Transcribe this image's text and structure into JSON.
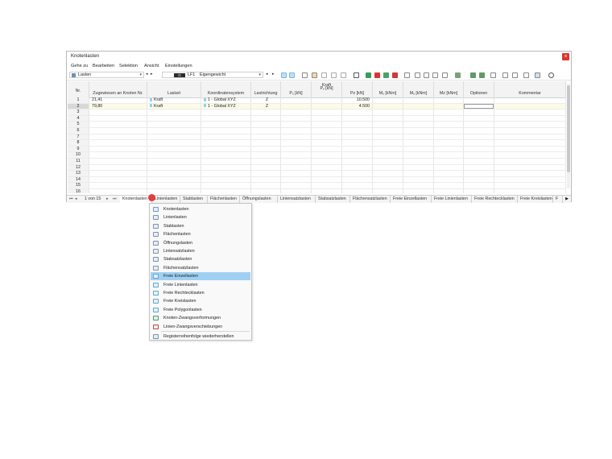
{
  "window": {
    "title": "Knotenlasten",
    "close_glyph": "×"
  },
  "menubar": [
    "Gehe zu",
    "Bearbeiten",
    "Selektion",
    "Ansicht",
    "Einstellungen"
  ],
  "toolbar": {
    "category": "Lasten",
    "loadcase_badge": "G",
    "loadcase_id": "LF1",
    "loadcase_name": "Eigengewicht"
  },
  "table": {
    "headers": {
      "nr": "Nr.",
      "knoten": "Zugewiesen an Knoten Nr.",
      "lastart": "Lastart",
      "koord": "Koordinatensystem",
      "richtung": "Lastrichtung",
      "kraft_group": "Kraft",
      "px": "Pₓ [kN]",
      "py": "Pᵧ [kN]",
      "pz": "Pz [kN]",
      "mx": "Mₓ [kNm]",
      "my": "Mᵧ [kNm]",
      "mz": "Mz [kNm]",
      "optionen": "Optionen",
      "kommentar": "Kommentar"
    },
    "rows": [
      {
        "nr": "1",
        "knoten": "21,41",
        "lastart": "Kraft",
        "koord": "1 - Global XYZ",
        "richtung": "Z",
        "pz": "10.500"
      },
      {
        "nr": "2",
        "knoten": "79,80",
        "lastart": "Kraft",
        "koord": "1 - Global XYZ",
        "richtung": "Z",
        "pz": "4.500"
      },
      {
        "nr": "3"
      },
      {
        "nr": "4"
      },
      {
        "nr": "5"
      },
      {
        "nr": "6"
      },
      {
        "nr": "7"
      },
      {
        "nr": "8"
      },
      {
        "nr": "9"
      },
      {
        "nr": "10"
      },
      {
        "nr": "11"
      },
      {
        "nr": "12"
      },
      {
        "nr": "13"
      },
      {
        "nr": "14"
      },
      {
        "nr": "15"
      },
      {
        "nr": "16"
      }
    ]
  },
  "tabbar": {
    "page_info": "1 von 15",
    "tabs": [
      "Knotenlasten",
      "Linienlasten",
      "Stablasten",
      "Flächenlasten",
      "Öffnungslasten",
      "Liniensatzlasten",
      "Stabsatzlasten",
      "Flächensatzlasten",
      "Freie Einzellasten",
      "Freie Linienlasten",
      "Freie Rechtecklasten",
      "Freie Kreislasten",
      "F"
    ]
  },
  "context_menu": {
    "items": [
      "Knotenlasten",
      "Linienlasten",
      "Stablasten",
      "Flächenlasten",
      "Öffnungslasten",
      "Liniensatzlasten",
      "Stabsatzlasten",
      "Flächensatzlasten",
      "Freie Einzellasten",
      "Freie Linienlasten",
      "Freie Rechtecklasten",
      "Freie Kreislasten",
      "Freie Polygonlasten",
      "Knoten-Zwangsverformungen",
      "Linien-Zwangsverschiebungen"
    ],
    "highlighted": "Freie Einzellasten",
    "footer_item": "Registerreihenfolge wiederherstellen"
  },
  "colors": {
    "selected_row": "#fdfbe6",
    "menu_highlight": "#9fd0f3",
    "close_button": "#d9352c",
    "load_swatch": "#8fd3f0"
  }
}
